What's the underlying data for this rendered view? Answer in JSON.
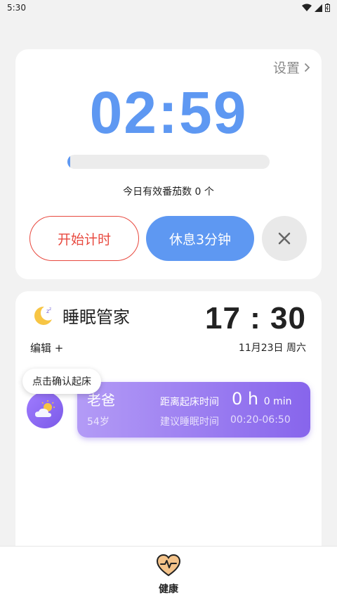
{
  "status_bar": {
    "time": "5:30"
  },
  "timer": {
    "settings_label": "设置",
    "time": "02:59",
    "progress": 0.01,
    "pomodoro_text": "今日有效番茄数 0 个",
    "start_label": "开始计时",
    "rest_label": "休息3分钟"
  },
  "sleep": {
    "title": "睡眠管家",
    "edit_label": "编辑 +",
    "clock_time": "17 : 30",
    "clock_date": "11月23日 周六",
    "tooltip": "点击确认起床",
    "member": {
      "name": "老爸",
      "age": "54岁",
      "wake_label": "距离起床时间",
      "wake_hours": "0 h",
      "wake_minutes": "0 min",
      "suggest_label": "建议睡眠时间",
      "suggest_value": "00:20-06:50"
    }
  },
  "nav": {
    "health_label": "健康"
  },
  "colors": {
    "accent_blue": "#5e98f2",
    "accent_red": "#e8493f",
    "purple": "#8765ec"
  }
}
